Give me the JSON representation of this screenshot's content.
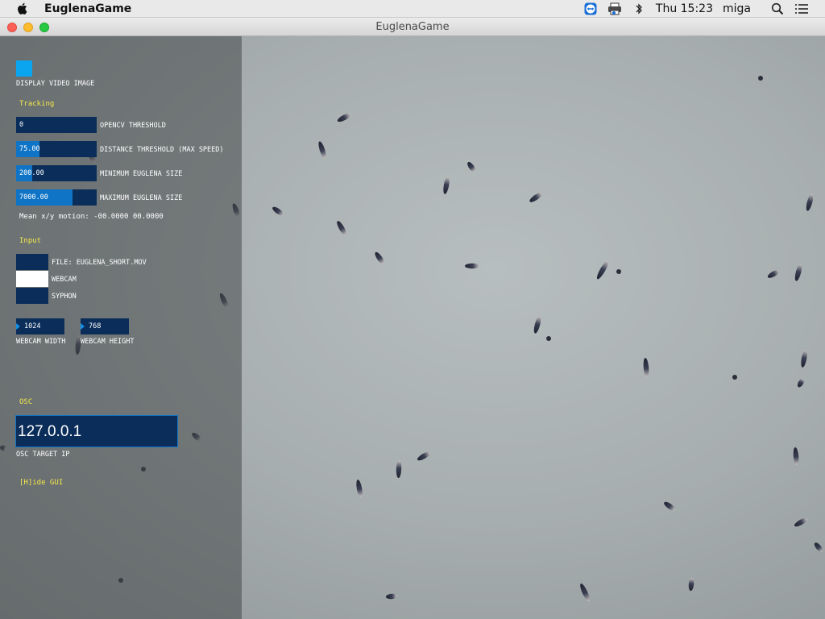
{
  "menubar": {
    "app_name": "EuglenaGame",
    "clock": "Thu 15:23",
    "user": "miga",
    "icons": [
      "apple-icon",
      "teamviewer-icon",
      "printer-icon",
      "bluetooth-icon",
      "search-icon",
      "list-icon"
    ]
  },
  "window": {
    "title": "EuglenaGame"
  },
  "gui": {
    "display_video_label": "DISPLAY VIDEO IMAGE",
    "tracking_header": "Tracking",
    "sliders": [
      {
        "value": "0",
        "label": "OPENCV THRESHOLD",
        "fraction": 0.0
      },
      {
        "value": "75.00",
        "label": "DISTANCE THRESHOLD (MAX SPEED)",
        "fraction": 0.29
      },
      {
        "value": "200.00",
        "label": "MINIMUM EUGLENA SIZE",
        "fraction": 0.2
      },
      {
        "value": "7000.00",
        "label": "MAXIMUM EUGLENA SIZE",
        "fraction": 0.7
      }
    ],
    "motion_text": "Mean x/y motion: -00.0000  00.0000",
    "input_header": "Input",
    "inputs": [
      {
        "label": "FILE: EUGLENA_SHORT.MOV",
        "selected": false
      },
      {
        "label": "WEBCAM",
        "selected": true
      },
      {
        "label": "SYPHON",
        "selected": false
      }
    ],
    "webcam_width": {
      "value": "1024",
      "label": "WEBCAM WIDTH"
    },
    "webcam_height": {
      "value": "768",
      "label": "WEBCAM HEIGHT"
    },
    "osc_header": "OSC",
    "osc_ip": "127.0.0.1",
    "osc_label": "OSC TARGET IP",
    "hide_gui": "[H]ide GUI"
  },
  "colors": {
    "toggle_on": "#0aa5ee",
    "control_bg": "#0b2d5a",
    "slider_fill": "#0f74c6",
    "section_text": "#f5e94a"
  }
}
